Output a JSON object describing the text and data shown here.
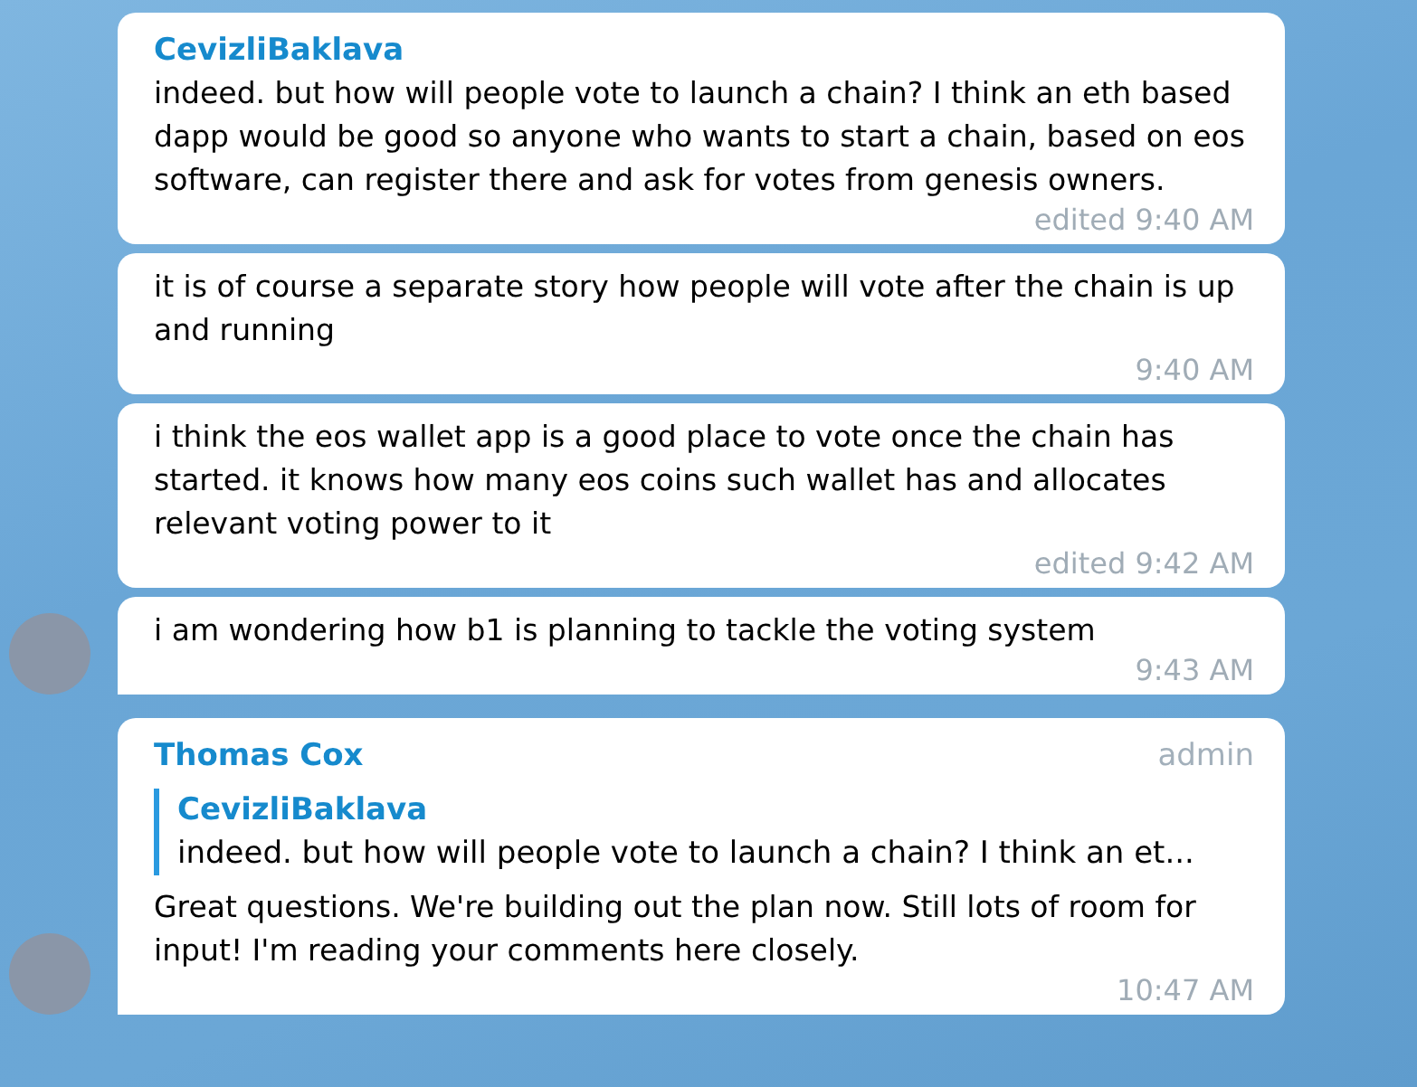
{
  "groups": [
    {
      "sender": "CevizliBaklava",
      "messages": [
        {
          "text": "indeed. but how will people vote to launch a chain? I think an eth based dapp would be good so anyone who wants to start a chain, based on eos software, can register there and ask for votes from genesis owners.",
          "time": "edited 9:40 AM"
        },
        {
          "text": "it is of course a separate story how people will vote after the chain is up and running",
          "time": "9:40 AM"
        },
        {
          "text": "i think the eos wallet app is a good place to vote once the chain has started. it knows how many eos coins such wallet has and allocates relevant voting power to it",
          "time": "edited 9:42 AM"
        },
        {
          "text": "i am wondering how b1 is planning to tackle the voting system",
          "time": "9:43 AM"
        }
      ]
    },
    {
      "sender": "Thomas Cox",
      "badge": "admin",
      "messages": [
        {
          "reply": {
            "sender": "CevizliBaklava",
            "text": "indeed. but how will people vote to launch a chain? I think an et..."
          },
          "text": "Great questions. We're building out the plan now. Still lots of room for input! I'm reading your comments here closely.",
          "time": "10:47 AM"
        }
      ]
    }
  ]
}
